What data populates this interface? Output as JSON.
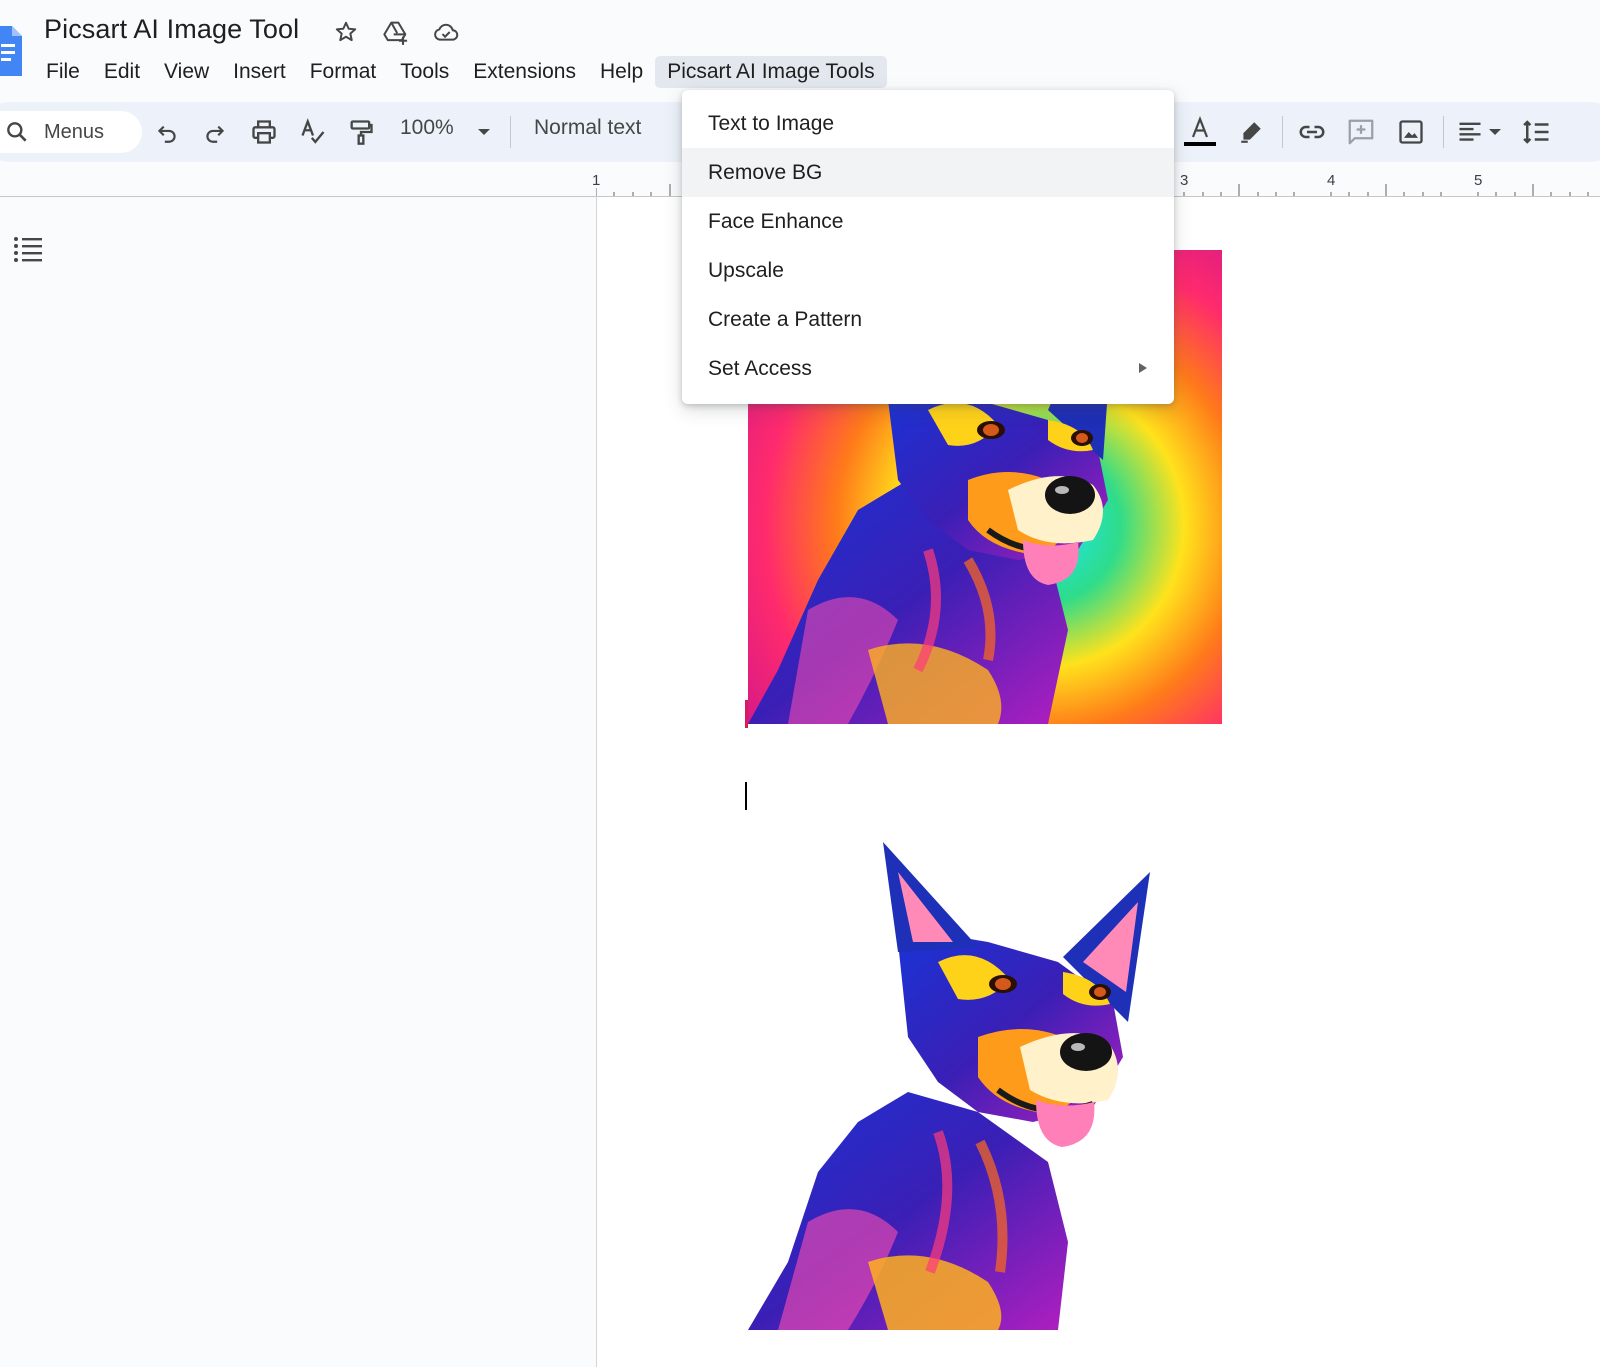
{
  "document": {
    "title": "Picsart AI Image Tool"
  },
  "menubar": {
    "items": [
      "File",
      "Edit",
      "View",
      "Insert",
      "Format",
      "Tools",
      "Extensions",
      "Help",
      "Picsart AI Image Tools"
    ],
    "active_index": 8
  },
  "toolbar": {
    "search_label": "Menus",
    "zoom": "100%",
    "style": "Normal text"
  },
  "ruler": {
    "labels": [
      "1",
      "3",
      "4",
      "5"
    ]
  },
  "dropdown": {
    "items": [
      {
        "label": "Text to Image",
        "has_submenu": false
      },
      {
        "label": "Remove BG",
        "has_submenu": false,
        "highlighted": true
      },
      {
        "label": "Face Enhance",
        "has_submenu": false
      },
      {
        "label": "Upscale",
        "has_submenu": false
      },
      {
        "label": "Create a Pattern",
        "has_submenu": false
      },
      {
        "label": "Set Access",
        "has_submenu": true
      }
    ]
  },
  "icons": {
    "title": [
      "star-icon",
      "drive-add-icon",
      "cloud-saved-icon"
    ],
    "toolbar": [
      "search-icon",
      "undo-icon",
      "redo-icon",
      "print-icon",
      "spellcheck-icon",
      "paint-format-icon",
      "dropdown-caret-icon",
      "text-color-icon",
      "highlight-icon",
      "link-icon",
      "add-comment-icon",
      "insert-image-icon",
      "align-icon",
      "line-spacing-icon"
    ]
  },
  "colors": {
    "docs_blue": "#4285f4",
    "toolbar_bg": "#edf2fa",
    "menu_active_bg": "#e3e7ee",
    "dropdown_hover": "#f1f3f4"
  }
}
